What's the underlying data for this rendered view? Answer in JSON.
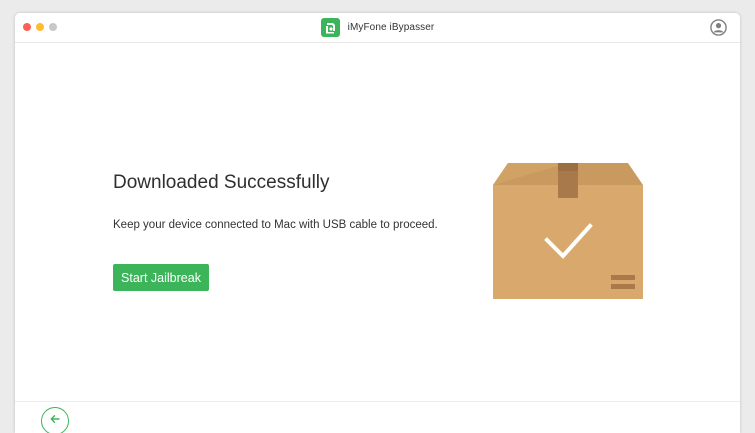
{
  "window": {
    "title": "iMyFone iBypasser",
    "traffic_lights": {
      "close_color": "#fe5f57",
      "minimize_color": "#febc2e",
      "zoom_color": "#c8c8c8"
    }
  },
  "brand": {
    "accent_color": "#3cb55a",
    "logo_icon": "imyfone-logo-icon"
  },
  "header": {
    "account_icon": "user-account-icon"
  },
  "main": {
    "heading": "Downloaded Successfully",
    "instruction": "Keep your device connected to Mac with USB cable to proceed.",
    "primary_button_label": "Start Jailbreak",
    "illustration": {
      "icon": "package-box-checkmark-icon",
      "box_color": "#d9a86c"
    }
  },
  "footer": {
    "back_icon": "back-arrow-icon"
  }
}
